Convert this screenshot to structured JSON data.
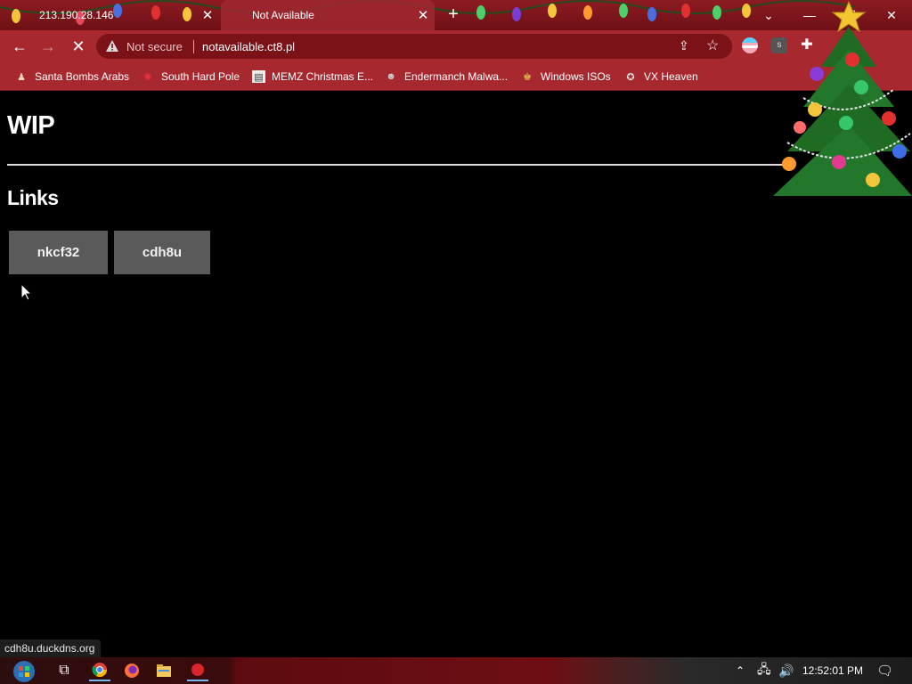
{
  "browser": {
    "tabs": [
      {
        "title": "213.190.28.146",
        "active": false
      },
      {
        "title": "Not Available",
        "active": true
      }
    ],
    "address": {
      "security_label": "Not secure",
      "url": "notavailable.ct8.pl"
    },
    "bookmarks": [
      {
        "label": "Santa Bombs Arabs"
      },
      {
        "label": "South Hard Pole"
      },
      {
        "label": "MEMZ Christmas E..."
      },
      {
        "label": "Endermanch Malwa..."
      },
      {
        "label": "Windows ISOs"
      },
      {
        "label": "VX Heaven"
      }
    ],
    "extension_s_label": "s"
  },
  "page": {
    "heading": "WIP",
    "subheading": "Links",
    "links": [
      {
        "label": "nkcf32"
      },
      {
        "label": "cdh8u"
      }
    ],
    "status_url": "cdh8u.duckdns.org"
  },
  "taskbar": {
    "clock": "12:52:01 PM"
  },
  "colors": {
    "chrome_red": "#a8282f",
    "tab_strip": "#8c1c22",
    "page_bg": "#000000",
    "link_button_bg": "#5a5a5a"
  }
}
